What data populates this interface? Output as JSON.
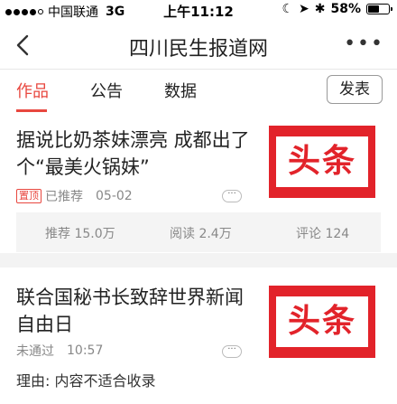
{
  "status_bar": {
    "carrier": "中国联通",
    "network": "3G",
    "time": "上午11:12",
    "battery": "58%",
    "battery_level": 0.58
  },
  "nav": {
    "back_icon": "chevron-left-icon",
    "title": "四川民生报道网",
    "more_icon": "more-horizontal-icon"
  },
  "tabs": [
    {
      "label": "作品",
      "active": true
    },
    {
      "label": "公告",
      "active": false
    },
    {
      "label": "数据",
      "active": false
    }
  ],
  "publish_label": "发表",
  "accent_color": "#e8473f",
  "articles": [
    {
      "title": "据说比奶茶妹漂亮 成都出了个“最美火锅妹”",
      "badge": "置顶",
      "status": "已推荐",
      "date": "05-02",
      "thumbnail_text": "头条",
      "stats": {
        "recommend": "推荐 15.0万",
        "read": "阅读 2.4万",
        "comment": "评论 124"
      }
    },
    {
      "title": "联合国秘书长致辞世界新闻自由日",
      "status": "未通过",
      "date": "10:57",
      "thumbnail_text": "头条",
      "reason": "理由: 内容不适合收录"
    }
  ]
}
